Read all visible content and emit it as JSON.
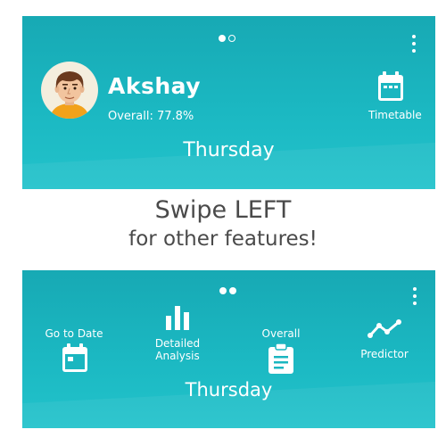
{
  "top_card": {
    "name": "Akshay",
    "overall": "Overall: 77.8%",
    "timetable_label": "Timetable",
    "day": "Thursday",
    "icons": [
      "avatar",
      "calendar-icon",
      "more-vert-icon"
    ]
  },
  "instruction": {
    "line1": "Swipe LEFT",
    "line2": "for other features!"
  },
  "bottom_card": {
    "go_to_date": "Go to Date",
    "detailed_line1": "Detailed",
    "detailed_line2": "Analysis",
    "overall": "Overall",
    "predictor": "Predictor",
    "day": "Thursday",
    "icons": [
      "calendar-icon",
      "bar-chart-icon",
      "clipboard-icon",
      "trend-line-icon",
      "more-vert-icon"
    ]
  },
  "colors": {
    "teal": "#1bb8c2",
    "text_dark": "#4a4a4a",
    "white": "#ffffff"
  }
}
